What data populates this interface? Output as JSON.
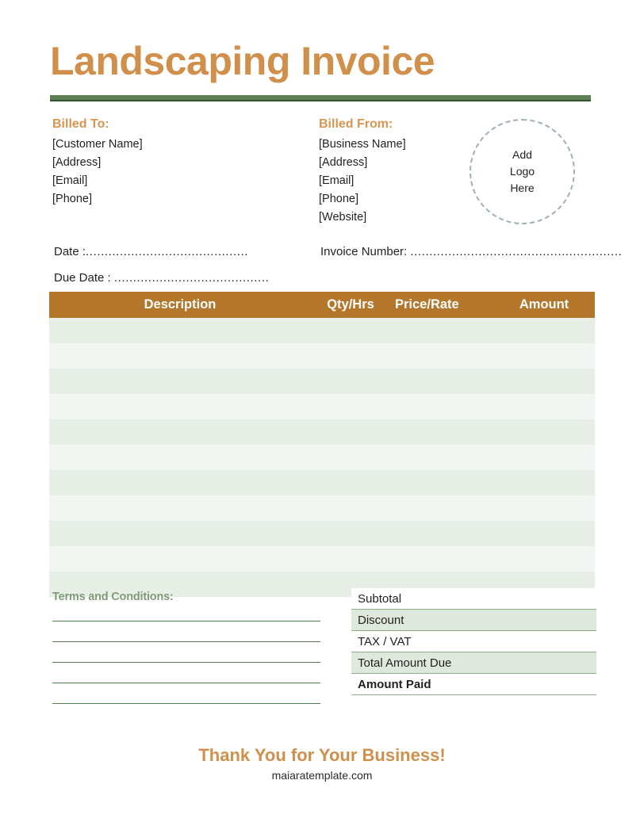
{
  "document": {
    "title": "Landscaping Invoice",
    "accent_orange": "#d08f4a",
    "accent_green": "#5d8053",
    "table_header_brown": "#b3762b"
  },
  "billed_to": {
    "heading": "Billed To:",
    "lines": [
      "[Customer Name]",
      "[Address]",
      "[Email]",
      "[Phone]"
    ]
  },
  "billed_from": {
    "heading": "Billed From:",
    "lines": [
      "[Business Name]",
      "[Address]",
      "[Email]",
      "[Phone]",
      "[Website]"
    ]
  },
  "logo": {
    "line1": "Add",
    "line2": "Logo",
    "line3": "Here"
  },
  "fields": {
    "date_label": "Date :",
    "date_dots": "...........................................",
    "due_date_label": "Due Date :",
    "due_date_dots": ".........................................",
    "invoice_number_label": "Invoice Number:",
    "invoice_number_dots": "........................................................"
  },
  "items_table": {
    "columns": [
      "Description",
      "Qty/Hrs",
      "Price/Rate",
      "Amount"
    ],
    "rows": [
      {
        "description": "",
        "qty": "",
        "price": "",
        "amount": ""
      },
      {
        "description": "",
        "qty": "",
        "price": "",
        "amount": ""
      },
      {
        "description": "",
        "qty": "",
        "price": "",
        "amount": ""
      },
      {
        "description": "",
        "qty": "",
        "price": "",
        "amount": ""
      },
      {
        "description": "",
        "qty": "",
        "price": "",
        "amount": ""
      },
      {
        "description": "",
        "qty": "",
        "price": "",
        "amount": ""
      },
      {
        "description": "",
        "qty": "",
        "price": "",
        "amount": ""
      },
      {
        "description": "",
        "qty": "",
        "price": "",
        "amount": ""
      },
      {
        "description": "",
        "qty": "",
        "price": "",
        "amount": ""
      },
      {
        "description": "",
        "qty": "",
        "price": "",
        "amount": ""
      },
      {
        "description": "",
        "qty": "",
        "price": "",
        "amount": ""
      }
    ]
  },
  "terms": {
    "heading": "Terms and Conditions:",
    "lines": [
      "",
      "",
      "",
      "",
      ""
    ]
  },
  "totals": {
    "rows": [
      {
        "label": "Subtotal",
        "value": "",
        "style": "plain"
      },
      {
        "label": "Discount",
        "value": "",
        "style": "tinted"
      },
      {
        "label": "TAX / VAT",
        "value": "",
        "style": "plain"
      },
      {
        "label": "Total Amount Due",
        "value": "",
        "style": "tinted"
      },
      {
        "label": "Amount Paid",
        "value": "",
        "style": "plain strong"
      }
    ]
  },
  "footer": {
    "thanks": "Thank You for Your Business!",
    "website": "maiaratemplate.com"
  }
}
